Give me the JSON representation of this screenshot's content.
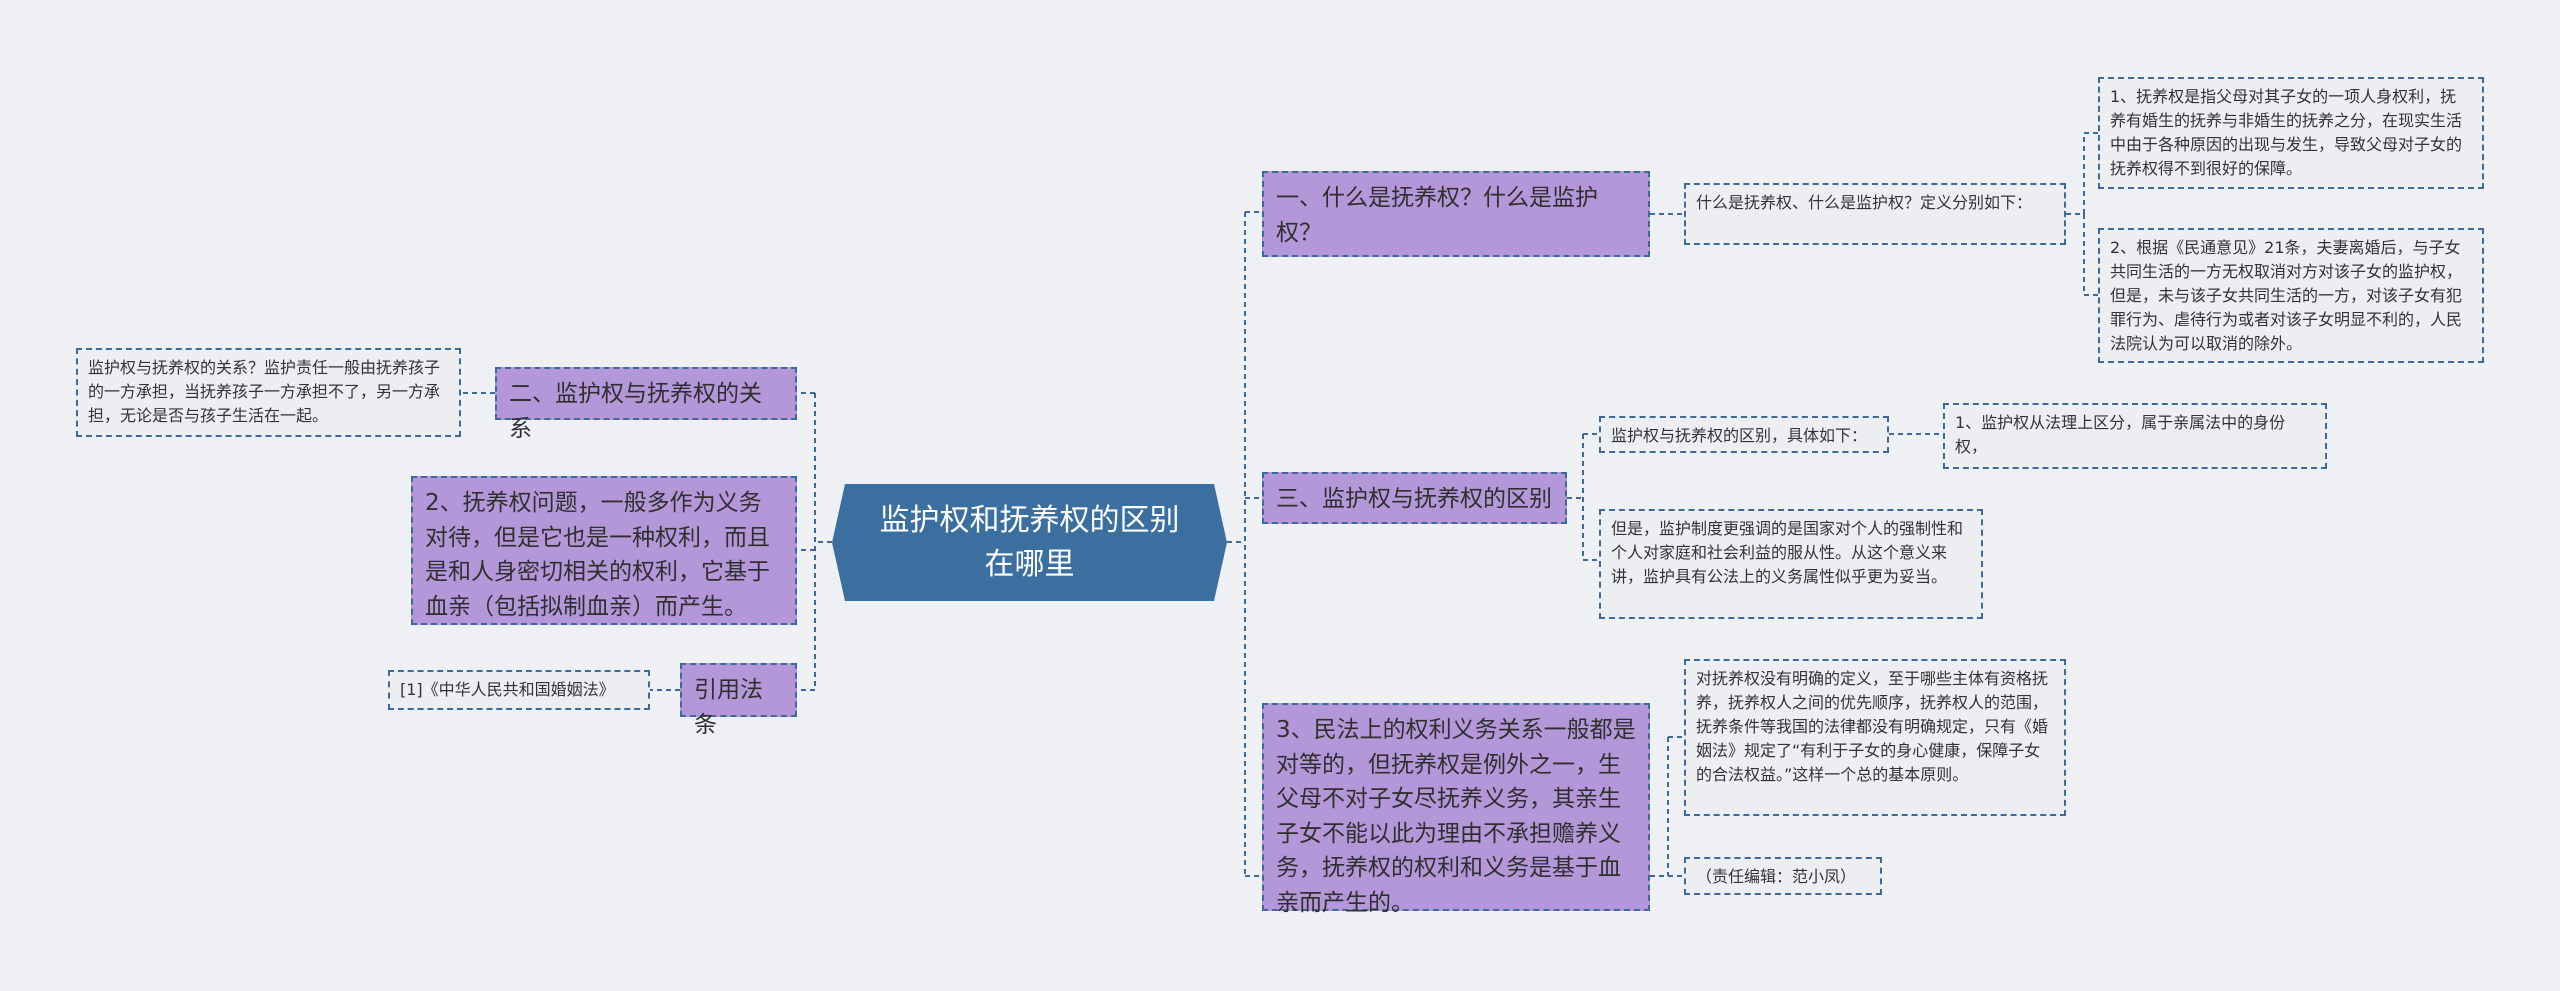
{
  "central": "监护权和抚养权的区别在哪里",
  "right": {
    "b1": {
      "label": "一、什么是抚养权？什么是监护权？",
      "sub": "什么是抚养权、什么是监护权？定义分别如下：",
      "d1": "1、抚养权是指父母对其子女的一项人身权利，抚养有婚生的抚养与非婚生的抚养之分，在现实生活中由于各种原因的出现与发生，导致父母对子女的抚养权得不到很好的保障。",
      "d2": "2、根据《民通意见》21条，夫妻离婚后，与子女共同生活的一方无权取消对方对该子女的监护权，但是，未与该子女共同生活的一方，对该子女有犯罪行为、虐待行为或者对该子女明显不利的，人民法院认为可以取消的除外。"
    },
    "b3": {
      "label": "三、监护权与抚养权的区别",
      "sub1": "监护权与抚养权的区别，具体如下：",
      "sub1d": "1、监护权从法理上区分，属于亲属法中的身份权，",
      "sub2": "但是，监护制度更强调的是国家对个人的强制性和个人对家庭和社会利益的服从性。从这个意义来讲，监护具有公法上的义务属性似乎更为妥当。"
    },
    "b4": {
      "label": "3、民法上的权利义务关系一般都是对等的，但抚养权是例外之一，生父母不对子女尽抚养义务，其亲生子女不能以此为理由不承担赡养义务，抚养权的权利和义务是基于血亲而产生的。",
      "sub1": "对抚养权没有明确的定义，至于哪些主体有资格抚养，抚养权人之间的优先顺序，抚养权人的范围，抚养条件等我国的法律都没有明确规定，只有《婚姻法》规定了“有利于子女的身心健康，保障子女的合法权益。”这样一个总的基本原则。",
      "sub2": "（责任编辑：范小凤）"
    }
  },
  "left": {
    "b2": {
      "label": "二、监护权与抚养权的关系",
      "sub": "监护权与抚养权的关系？监护责任一般由抚养孩子的一方承担，当抚养孩子一方承担不了，另一方承担，无论是否与孩子生活在一起。"
    },
    "b5": {
      "label": "2、抚养权问题，一般多作为义务对待，但是它也是一种权利，而且是和人身密切相关的权利，它基于血亲（包括拟制血亲）而产生。"
    },
    "b6": {
      "label": "引用法条",
      "sub": "[1]《中华人民共和国婚姻法》"
    }
  },
  "colors": {
    "background": "#eef0f4",
    "central": "#3b6fa0",
    "branch_fill": "#b497d9",
    "leaf_fill": "#eceef2",
    "border": "#3e6a99"
  }
}
